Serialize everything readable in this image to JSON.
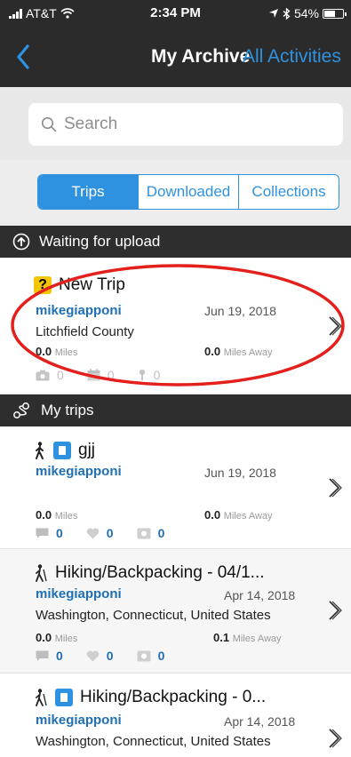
{
  "status_bar": {
    "carrier": "AT&T",
    "time": "2:34 PM",
    "battery": "54%"
  },
  "nav": {
    "title": "My Archive",
    "link": "All Activities"
  },
  "search": {
    "placeholder": "Search"
  },
  "segments": [
    "Trips",
    "Downloaded",
    "Collections"
  ],
  "sections": {
    "waiting": "Waiting for upload",
    "my_trips": "My trips"
  },
  "upload_trip": {
    "name": "New Trip",
    "user": "mikegiapponi",
    "date": "Jun 19, 2018",
    "location": "Litchfield County",
    "miles": "0.0",
    "miles_unit": "Miles",
    "away": "0.0",
    "away_unit": "Miles Away",
    "photos": "0",
    "calendar": "0",
    "waypoints": "0"
  },
  "trips": [
    {
      "name": "gjj",
      "user": "mikegiapponi",
      "date": "Jun 19, 2018",
      "location": "",
      "miles": "0.0",
      "miles_unit": "Miles",
      "away": "0.0",
      "away_unit": "Miles Away",
      "comments": "0",
      "likes": "0",
      "photos": "0"
    },
    {
      "name": "Hiking/Backpacking - 04/1...",
      "user": "mikegiapponi",
      "date": "Apr 14, 2018",
      "location": "Washington, Connecticut, United States",
      "miles": "0.0",
      "miles_unit": "Miles",
      "away": "0.1",
      "away_unit": "Miles Away",
      "comments": "0",
      "likes": "0",
      "photos": "0"
    },
    {
      "name": "Hiking/Backpacking - 0...",
      "user": "mikegiapponi",
      "date": "Apr 14, 2018",
      "location": "Washington, Connecticut, United States"
    }
  ],
  "colors": {
    "accent": "#2f92e0",
    "dark_bar": "#2b2b2b",
    "annotation": "#e3201b",
    "badge_yellow": "#f5c400"
  }
}
